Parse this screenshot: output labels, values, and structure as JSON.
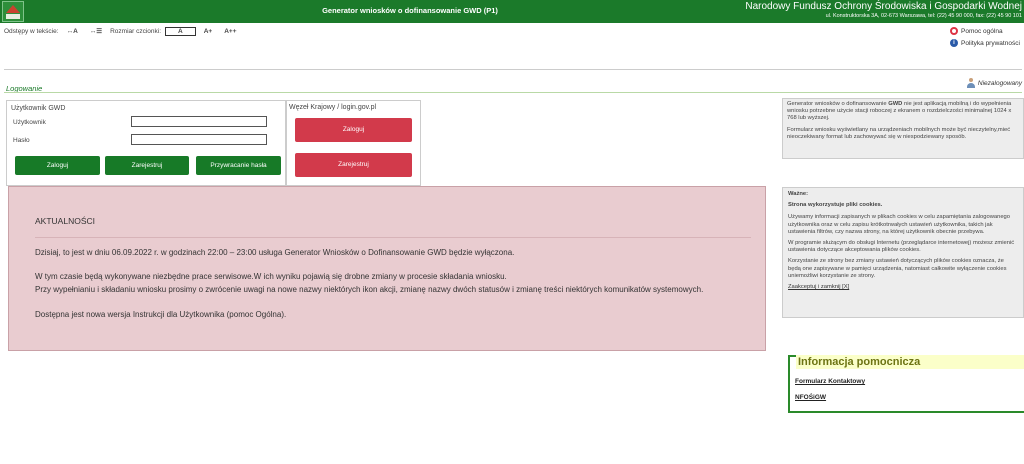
{
  "header": {
    "app_title": "Generator wniosków o dofinansowanie GWD (P1)",
    "org_name": "Narodowy Fundusz Ochrony Środowiska i Gospodarki Wodnej",
    "org_address": "ul. Konstruktorska 3A, 02-673 Warszawa, tel: (22) 45 90 000, fax: (22) 45 90 101",
    "bar_color": "#1b7a2a"
  },
  "toolbar": {
    "spacing_label": "Odstępy w tekście:",
    "spacing_letter": "↔A",
    "spacing_line": "↔☰",
    "font_size_label": "Rozmiar czcionki:",
    "font_a": "A",
    "font_a_plus": "A+",
    "font_a_plus_plus": "A++"
  },
  "help_links": {
    "general_help": "Pomoc ogólna",
    "privacy_policy": "Polityka prywatności"
  },
  "section": {
    "login_heading": "Logowanie",
    "user_status": "Niezalogowany"
  },
  "login_gwd": {
    "title": "Użytkownik GWD",
    "user_label": "Użytkownik",
    "user_value": "",
    "password_label": "Hasło",
    "password_value": "",
    "login_button": "Zaloguj",
    "register_button": "Zarejestruj",
    "reset_button": "Przywracanie hasła"
  },
  "login_wezel": {
    "title": "Węzeł Krajowy / login.gov.pl",
    "login_button": "Zaloguj",
    "register_button": "Zarejestruj"
  },
  "news": {
    "heading": "AKTUALNOŚCI",
    "line1": "Dzisiaj, to jest w dniu 06.09.2022 r. w godzinach 22:00 – 23:00 usługa Generator Wniosków o Dofinansowanie GWD będzie wyłączona.",
    "line2": "W tym czasie będą wykonywane niezbędne prace serwisowe.W ich wyniku pojawią się drobne zmiany w procesie składania wniosku.",
    "line3": "Przy wypełnianiu i składaniu wniosku prosimy o zwrócenie uwagi na nowe nazwy niektórych ikon akcji, zmianę nazwy dwóch statusów i zmianę treści niektórych komunikatów systemowych.",
    "line4": "Dostępna jest nowa wersja Instrukcji dla Użytkownika (pomoc Ogólna)."
  },
  "side_info": {
    "p1_pre": "Generator wniosków o dofinansowanie ",
    "p1_bold": "GWD",
    "p1_post": " nie jest aplikacją mobilną i do wypełnienia wniosku potrzebne użycie stacji roboczej z ekranem o rozdzielczości minimalnej 1024 x 768 lub wyższej.",
    "p2": "Formularz wniosku wyświetlany na urządzeniach mobilnych może być nieczytelny,mieć nieoczekiwany format lub zachowywać się w niespodziewany sposób."
  },
  "cookies": {
    "title": "Ważne:",
    "subtitle": "Strona wykorzystuje pliki cookies.",
    "p1": "Używamy informacji zapisanych w plikach cookies w celu zapamiętania zalogowanego użytkownika oraz w celu zapisu krótkotrwałych ustawień użytkownika, takich jak ustawienia filtrów, czy nazwa strony, na której użytkownik obecnie przebywa.",
    "p2": "W programie służącym do obsługi Internetu (przeglądarce internetowej) możesz zmienić ustawienia dotyczące akceptowania plików cookies.",
    "p3": "Korzystanie ze strony bez zmiany ustawień dotyczących plików cookies oznacza, że będą one zapisywane w pamięci urządzenia, natomiast całkowite wyłączenie cookies uniemożliwi korzystanie ze strony.",
    "accept_link": "Zaakceptuj i zamknij [X]"
  },
  "help_box": {
    "title": "Informacja pomocnicza",
    "contact_form": "Formularz Kontaktowy",
    "nfosigw": "NFOŚiGW"
  }
}
